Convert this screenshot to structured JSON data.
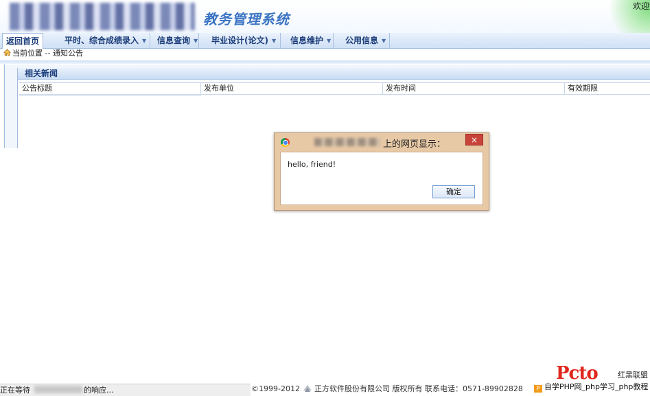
{
  "header": {
    "system_title": "教务管理系统",
    "welcome": "欢迎您"
  },
  "nav": [
    {
      "label": "返回首页",
      "has_dropdown": false,
      "active": true
    },
    {
      "label": "平时、综合成绩录入",
      "has_dropdown": true
    },
    {
      "label": "信息查询",
      "has_dropdown": true
    },
    {
      "label": "毕业设计(论文)",
      "has_dropdown": true
    },
    {
      "label": "信息维护",
      "has_dropdown": true
    },
    {
      "label": "公用信息",
      "has_dropdown": true
    }
  ],
  "breadcrumb": {
    "prefix": "当前位置",
    "separator": "--",
    "current": "通知公告"
  },
  "panel": {
    "title": "相关新闻",
    "columns": [
      "公告标题",
      "发布单位",
      "发布时间",
      "有效期限"
    ]
  },
  "dialog": {
    "title_suffix": "上的网页显示：",
    "close": "×",
    "message": "hello, friend!",
    "ok": "确定"
  },
  "status": {
    "prefix": "正在等待",
    "suffix": "的响应..."
  },
  "footer": {
    "copyright": "©1999-2012",
    "company": "正方软件股份有限公司 版权所有",
    "phone": "联系电话：0571-89902828"
  },
  "watermark": {
    "logo": "Pcto",
    "tag": "红黑联盟",
    "text": "自学PHP网_php学习_php教程"
  },
  "colors": {
    "nav_text": "#1c3d7a",
    "title_blue": "#3a73c2",
    "dialog_frame": "#e8c9a6",
    "close_red": "#c7443a"
  }
}
